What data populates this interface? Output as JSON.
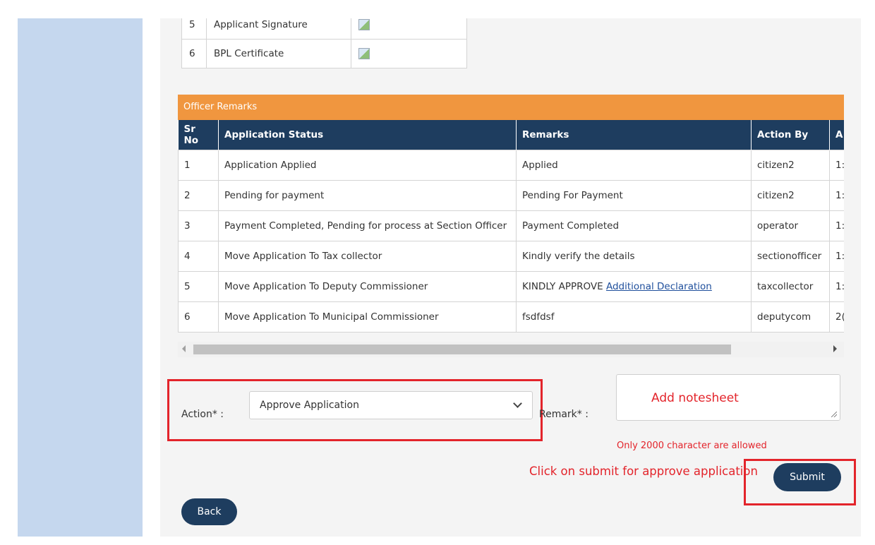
{
  "documents": {
    "rows": [
      {
        "no": "5",
        "name": "Applicant Signature"
      },
      {
        "no": "6",
        "name": "BPL Certificate"
      }
    ]
  },
  "officer_remarks": {
    "title": "Officer Remarks",
    "columns": [
      "Sr No",
      "Application Status",
      "Remarks",
      "Action By",
      "A"
    ],
    "rows": [
      {
        "sr": "1",
        "status": "Application Applied",
        "remarks": "Applied",
        "action_by": "citizen2",
        "extra": "1:"
      },
      {
        "sr": "2",
        "status": "Pending for payment",
        "remarks": "Pending For Payment",
        "action_by": "citizen2",
        "extra": "1:"
      },
      {
        "sr": "3",
        "status": "Payment Completed, Pending for process at Section Officer",
        "remarks": "Payment Completed",
        "action_by": "operator",
        "extra": "1:"
      },
      {
        "sr": "4",
        "status": "Move Application To Tax collector",
        "remarks": "Kindly verify the details",
        "action_by": "sectionofficer",
        "extra": "1:"
      },
      {
        "sr": "5",
        "status": "Move Application To Deputy Commissioner",
        "remarks": "KINDLY APPROVE",
        "remarks_link": "Additional Declaration",
        "action_by": "taxcollector",
        "extra": "1:"
      },
      {
        "sr": "6",
        "status": "Move Application To Municipal Commissioner",
        "remarks": "fsdfdsf",
        "action_by": "deputycom",
        "extra": "2("
      }
    ]
  },
  "form": {
    "action_label": "Action* :",
    "action_value": "Approve Application",
    "remark_label": "Remark* :",
    "remark_annotation": "Add notesheet",
    "char_limit_hint": "Only 2000 character are allowed",
    "submit_hint": "Click on submit for approve application",
    "submit_label": "Submit",
    "back_label": "Back"
  },
  "colors": {
    "sidebar": "#c5d7ee",
    "header_orange": "#f0963f",
    "table_header_navy": "#1e3d5f",
    "annotation_red": "#e3242b"
  }
}
